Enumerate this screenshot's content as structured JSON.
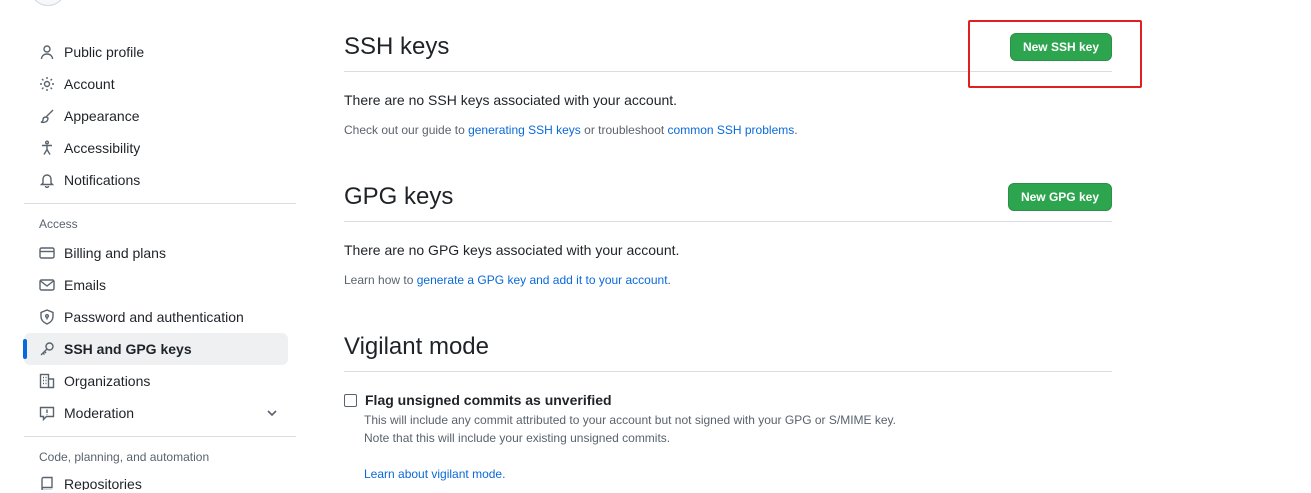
{
  "sidebar": {
    "items_top": [
      {
        "label": "Public profile",
        "icon": "person-icon"
      },
      {
        "label": "Account",
        "icon": "gear-icon"
      },
      {
        "label": "Appearance",
        "icon": "paintbrush-icon"
      },
      {
        "label": "Accessibility",
        "icon": "accessibility-icon"
      },
      {
        "label": "Notifications",
        "icon": "bell-icon"
      }
    ],
    "access_label": "Access",
    "items_access": [
      {
        "label": "Billing and plans",
        "icon": "credit-card-icon"
      },
      {
        "label": "Emails",
        "icon": "mail-icon"
      },
      {
        "label": "Password and authentication",
        "icon": "shield-lock-icon"
      },
      {
        "label": "SSH and GPG keys",
        "icon": "key-icon",
        "active": true
      },
      {
        "label": "Organizations",
        "icon": "organization-icon"
      },
      {
        "label": "Moderation",
        "icon": "report-icon"
      }
    ],
    "code_label": "Code, planning, and automation",
    "partial_item": "Repositories"
  },
  "ssh": {
    "title": "SSH keys",
    "button": "New SSH key",
    "empty": "There are no SSH keys associated with your account.",
    "note_pre": "Check out our guide to ",
    "note_link1": "generating SSH keys",
    "note_mid": " or troubleshoot ",
    "note_link2": "common SSH problems",
    "note_end": "."
  },
  "gpg": {
    "title": "GPG keys",
    "button": "New GPG key",
    "empty": "There are no GPG keys associated with your account.",
    "note_pre": "Learn how to ",
    "note_link": "generate a GPG key and add it to your account",
    "note_end": "."
  },
  "vigilant": {
    "title": "Vigilant mode",
    "checkbox_label": "Flag unsigned commits as unverified",
    "desc1": "This will include any commit attributed to your account but not signed with your GPG or S/MIME key.",
    "desc2": "Note that this will include your existing unsigned commits.",
    "link": "Learn about vigilant mode."
  },
  "colors": {
    "accent": "#0969da",
    "primary_button": "#2da44e",
    "highlight": "#e02020"
  }
}
